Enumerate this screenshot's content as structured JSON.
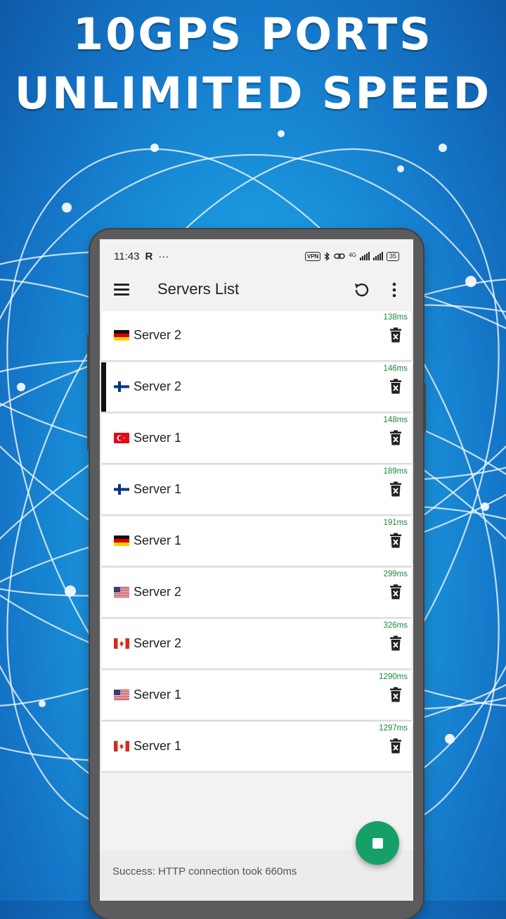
{
  "promo": {
    "line1": "10GPS PORTS",
    "line2": "UNLIMITED SPEED"
  },
  "status_bar": {
    "time": "11:43",
    "r_badge": "R",
    "dots": "···",
    "vpn": "VPN",
    "network": "4G",
    "battery": "35"
  },
  "app_bar": {
    "title": "Servers List"
  },
  "servers": [
    {
      "flag": "germany",
      "name": "Server 2",
      "latency": "138ms",
      "selected": false
    },
    {
      "flag": "finland",
      "name": "Server 2",
      "latency": "146ms",
      "selected": true
    },
    {
      "flag": "turkey",
      "name": "Server 1",
      "latency": "148ms",
      "selected": false
    },
    {
      "flag": "finland",
      "name": "Server 1",
      "latency": "189ms",
      "selected": false
    },
    {
      "flag": "germany",
      "name": "Server 1",
      "latency": "191ms",
      "selected": false
    },
    {
      "flag": "usa",
      "name": "Server 2",
      "latency": "299ms",
      "selected": false
    },
    {
      "flag": "canada",
      "name": "Server 2",
      "latency": "326ms",
      "selected": false
    },
    {
      "flag": "usa",
      "name": "Server 1",
      "latency": "1290ms",
      "selected": false
    },
    {
      "flag": "canada",
      "name": "Server 1",
      "latency": "1297ms",
      "selected": false
    }
  ],
  "snackbar": {
    "message": "Success: HTTP connection took 660ms"
  },
  "colors": {
    "fab": "#16a067",
    "latency": "#1a8a3c"
  },
  "icons": {
    "menu": "hamburger-icon",
    "refresh": "refresh-icon",
    "more": "more-vert-icon",
    "delete": "trash-icon",
    "fab": "stop-icon"
  }
}
